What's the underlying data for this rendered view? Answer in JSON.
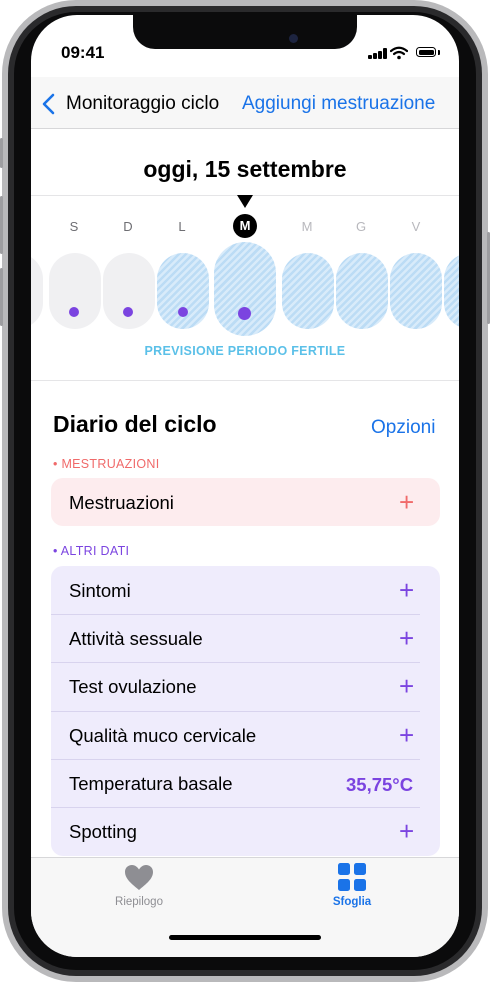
{
  "status_bar": {
    "time": "09:41"
  },
  "nav": {
    "back_label": "Monitoraggio ciclo",
    "action_label": "Aggiungi mestruazione"
  },
  "calendar": {
    "date_title": "oggi, 15 settembre",
    "days": [
      {
        "letter": "S",
        "state": "past",
        "fertile": false,
        "logged": true
      },
      {
        "letter": "D",
        "state": "past",
        "fertile": false,
        "logged": true
      },
      {
        "letter": "L",
        "state": "past",
        "fertile": true,
        "logged": true
      },
      {
        "letter": "M",
        "state": "today",
        "fertile": true,
        "logged": true
      },
      {
        "letter": "M",
        "state": "future",
        "fertile": true,
        "logged": false
      },
      {
        "letter": "G",
        "state": "future",
        "fertile": true,
        "logged": false
      },
      {
        "letter": "V",
        "state": "future",
        "fertile": true,
        "logged": false
      }
    ],
    "fertile_label": "PREVISIONE PERIODO FERTILE"
  },
  "diario": {
    "title": "Diario del ciclo",
    "options_label": "Opzioni",
    "mestruazioni_header": "• MESTRUAZIONI",
    "mestruazioni_row": {
      "label": "Mestruazioni",
      "value": "+"
    },
    "altri_header": "• ALTRI DATI",
    "altri_rows": [
      {
        "label": "Sintomi",
        "value": "+"
      },
      {
        "label": "Attività sessuale",
        "value": "+"
      },
      {
        "label": "Test ovulazione",
        "value": "+"
      },
      {
        "label": "Qualità muco cervicale",
        "value": "+"
      },
      {
        "label": "Temperatura basale",
        "value": "35,75°C"
      },
      {
        "label": "Spotting",
        "value": "+"
      }
    ]
  },
  "tab_bar": {
    "tabs": [
      {
        "label": "Riepilogo",
        "icon": "heart-icon",
        "selected": false
      },
      {
        "label": "Sfoglia",
        "icon": "grid-icon",
        "selected": true
      }
    ]
  },
  "colors": {
    "accent_blue": "#1a73e8",
    "menstruation_red": "#f06a6a",
    "other_data_purple": "#7b44e0",
    "fertile_blue": "#5bc0e8"
  }
}
